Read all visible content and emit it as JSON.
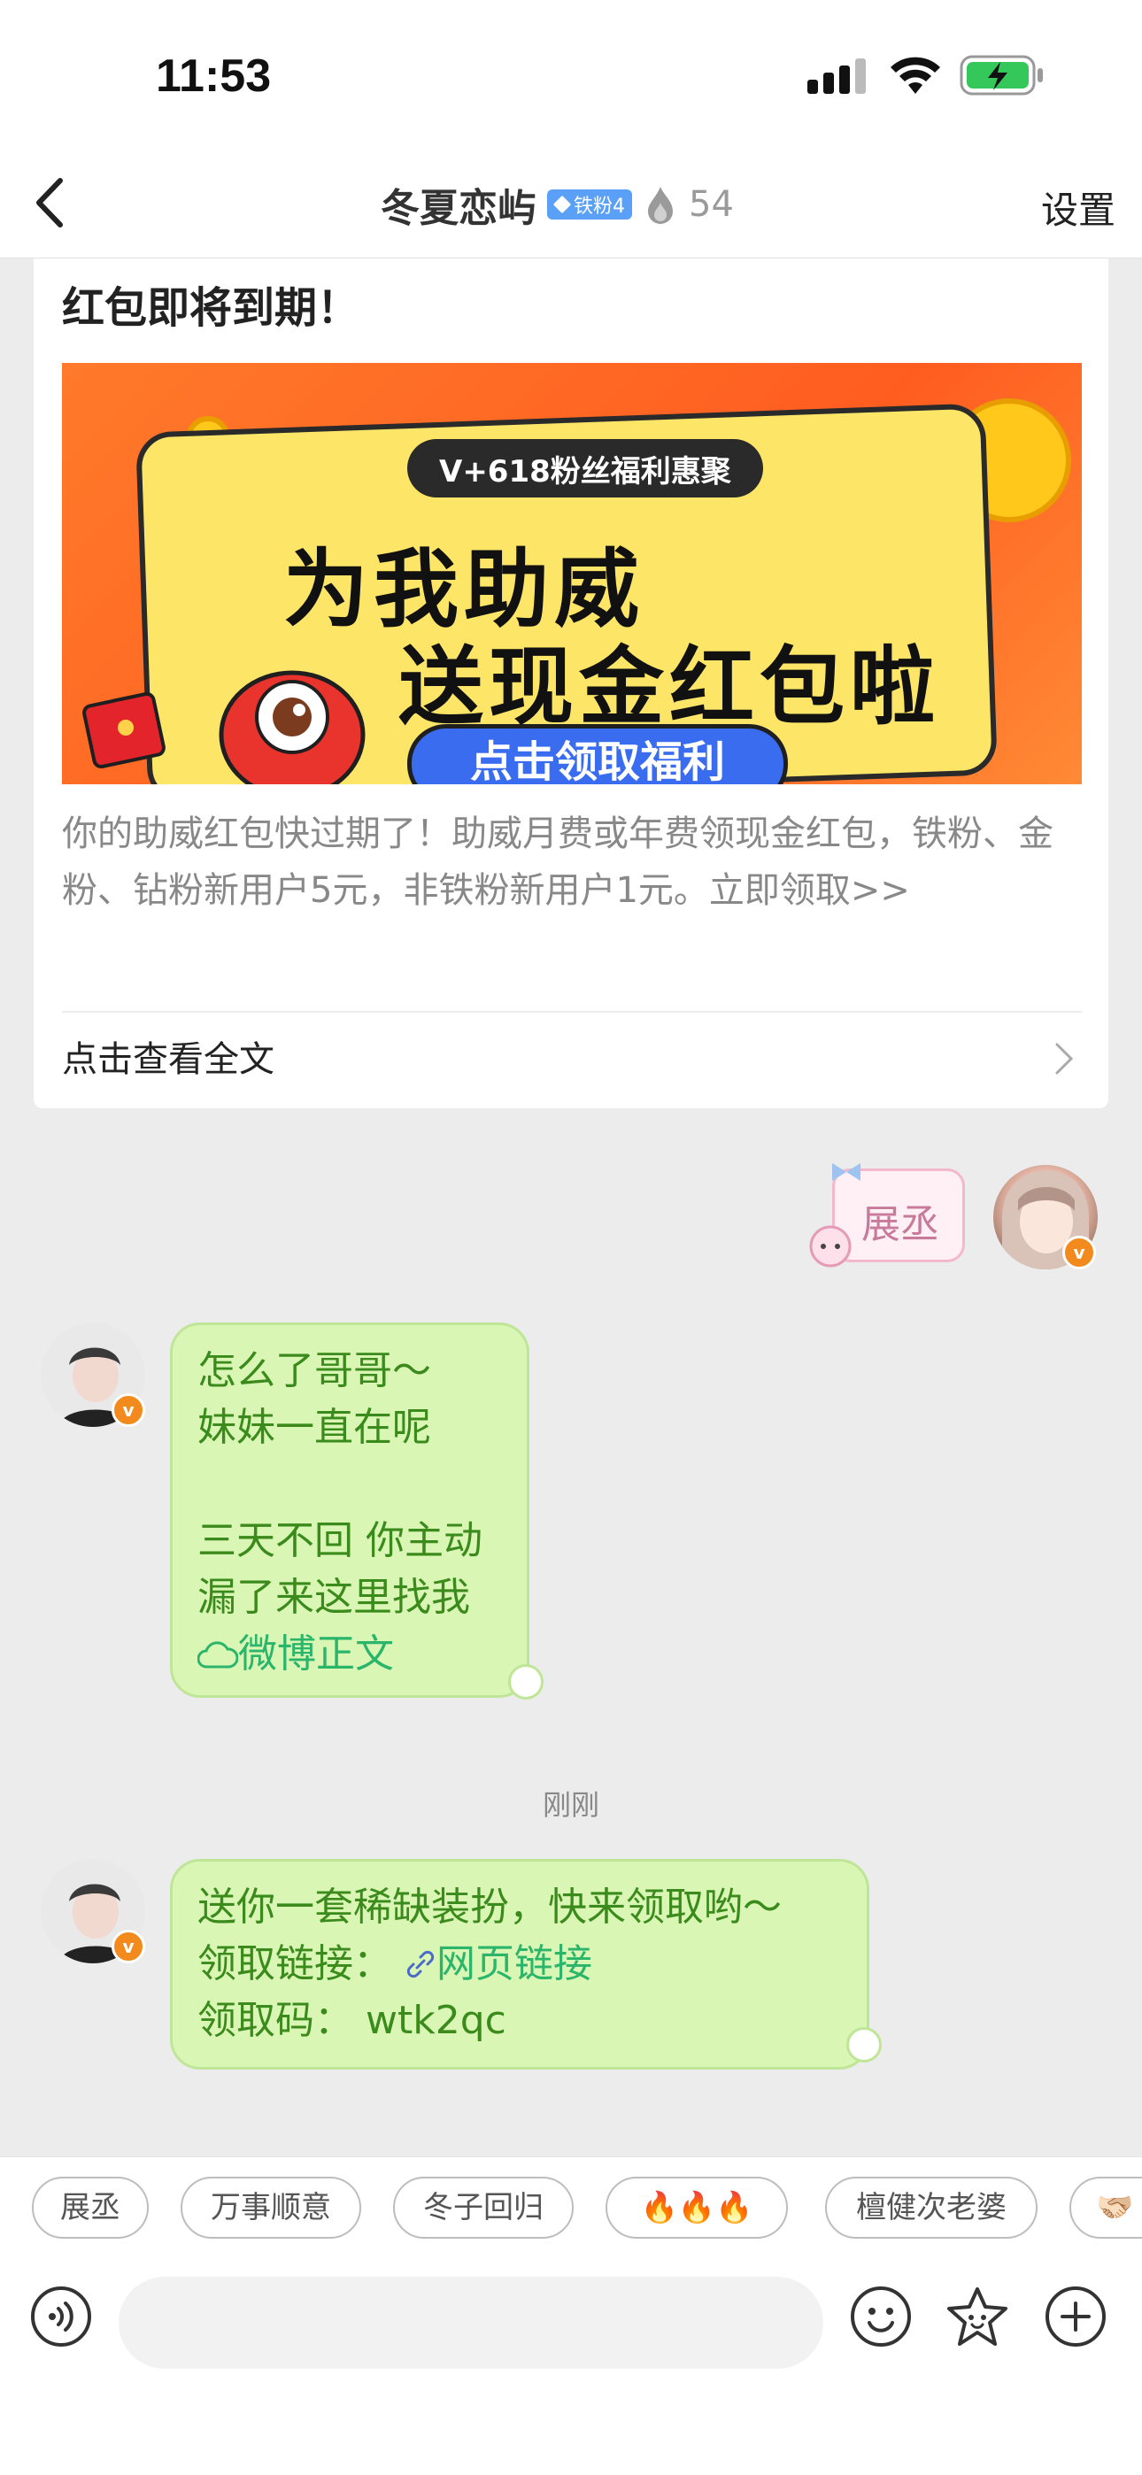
{
  "status_bar": {
    "time": "11:53"
  },
  "header": {
    "title": "冬夏恋屿",
    "fan_badge": "铁粉4",
    "fan_count": "54",
    "settings": "设置"
  },
  "article": {
    "heading": "红包即将到期！",
    "banner": {
      "tag": "V+618粉丝福利惠聚",
      "title_line1": "为我助威",
      "title_line2": "送现金红包啦",
      "cta": "点击领取福利"
    },
    "summary": "你的助威红包快过期了！助威月费或年费领现金红包，铁粉、金粉、钻粉新用户5元，非铁粉新用户1元。立即领取>>",
    "read_full": "点击查看全文"
  },
  "chat": {
    "outgoing_sticker": "展丞",
    "messages": [
      {
        "lines": [
          "怎么了哥哥～",
          "妹妹一直在呢",
          "",
          "三天不回 你主动",
          "漏了来这里找我"
        ],
        "link": "微博正文"
      },
      {
        "line1": "送你一套稀缺装扮，快来领取哟～",
        "link_label": "领取链接：",
        "link": "网页链接",
        "code_label": "领取码：",
        "code": "wtk2qc"
      }
    ],
    "time_divider": "刚刚"
  },
  "quick_replies": [
    "展丞",
    "万事顺意",
    "冬子回归",
    "🔥🔥🔥",
    "檀健次老婆",
    "🫱🏻‍🫲🏼"
  ],
  "input": {
    "placeholder": ""
  },
  "colors": {
    "bubble_bg": "#d9f6b5",
    "bubble_text": "#3b8a1c",
    "link": "#2bb56a",
    "verify_badge": "#f28a1e",
    "fan_badge": "#5aa0f7"
  }
}
